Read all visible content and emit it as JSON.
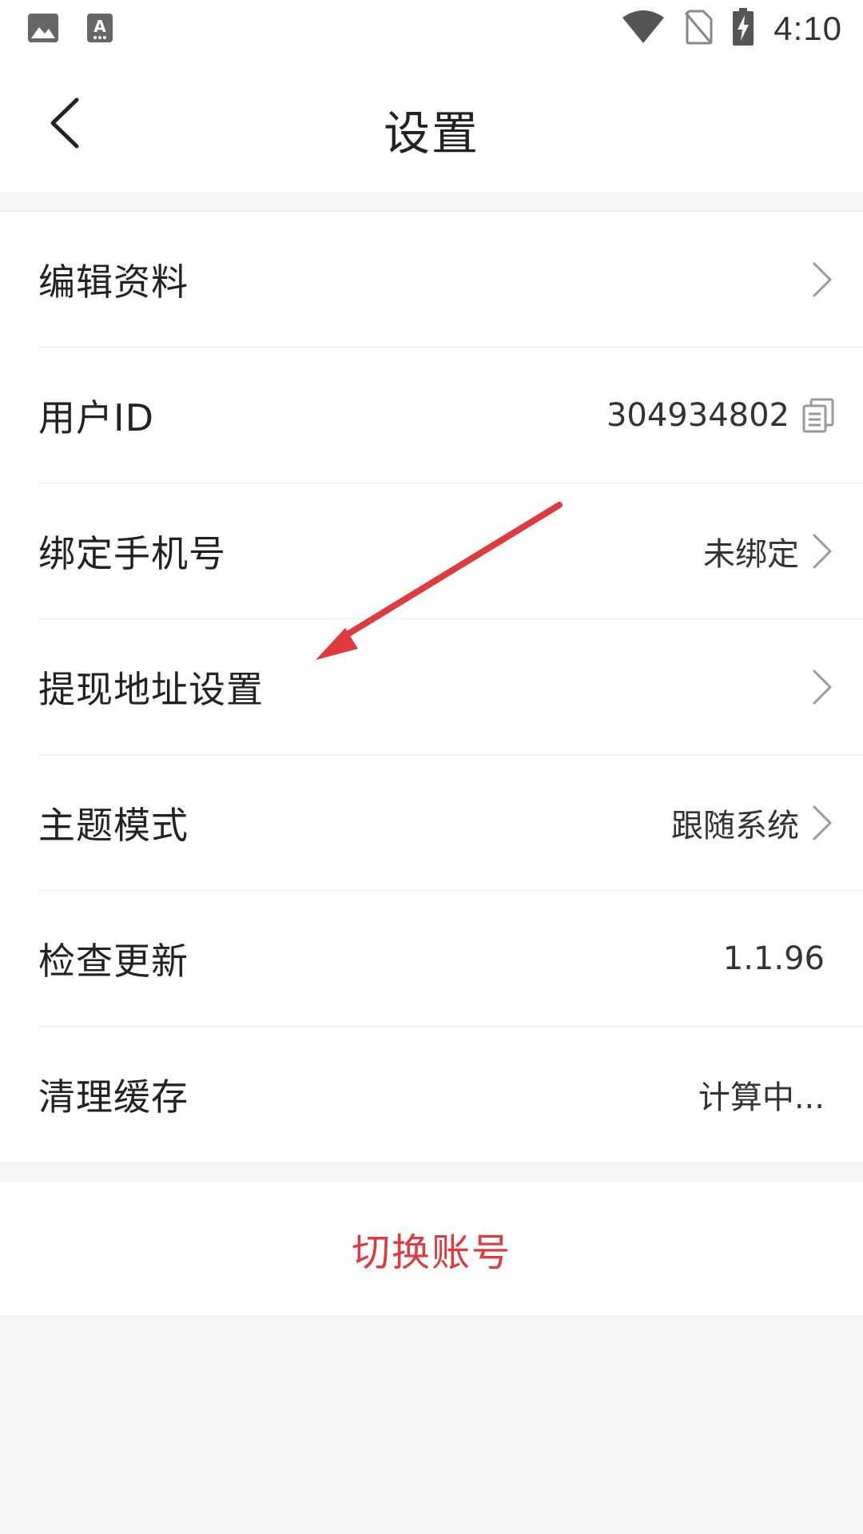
{
  "status_bar": {
    "time": "4:10",
    "icons": [
      "image-icon",
      "text-a-icon",
      "wifi-icon",
      "no-sim-icon",
      "battery-charging-icon"
    ]
  },
  "header": {
    "title": "设置",
    "back_icon": "chevron-left-icon"
  },
  "settings": {
    "items": [
      {
        "label": "编辑资料",
        "value": "",
        "trailing": "chevron-right-icon"
      },
      {
        "label": "用户ID",
        "value": "304934802",
        "trailing": "copy-icon"
      },
      {
        "label": "绑定手机号",
        "value": "未绑定",
        "trailing": "chevron-right-icon"
      },
      {
        "label": "提现地址设置",
        "value": "",
        "trailing": "chevron-right-icon"
      },
      {
        "label": "主题模式",
        "value": "跟随系统",
        "trailing": "chevron-right-icon"
      },
      {
        "label": "检查更新",
        "value": "1.1.96",
        "trailing": ""
      },
      {
        "label": "清理缓存",
        "value": "计算中...",
        "trailing": ""
      }
    ]
  },
  "switch_account": {
    "label": "切换账号"
  },
  "colors": {
    "accent_red": "#e0393e",
    "background": "#f5f6f6",
    "divider": "#ececec",
    "chevron": "#999999"
  }
}
